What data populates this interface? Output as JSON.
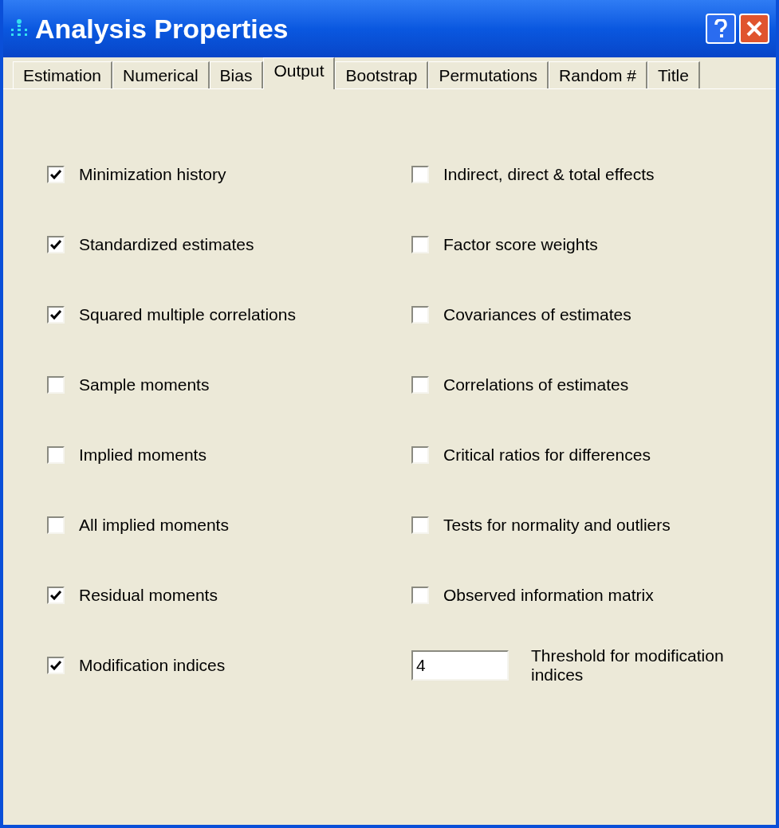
{
  "window": {
    "title": "Analysis Properties"
  },
  "tabs": [
    {
      "label": "Estimation",
      "selected": false
    },
    {
      "label": "Numerical",
      "selected": false
    },
    {
      "label": "Bias",
      "selected": false
    },
    {
      "label": "Output",
      "selected": true
    },
    {
      "label": "Bootstrap",
      "selected": false
    },
    {
      "label": "Permutations",
      "selected": false
    },
    {
      "label": "Random #",
      "selected": false
    },
    {
      "label": "Title",
      "selected": false
    }
  ],
  "left_options": [
    {
      "kind": "checkbox",
      "label": "Minimization history",
      "checked": true
    },
    {
      "kind": "checkbox",
      "label": "Standardized estimates",
      "checked": true
    },
    {
      "kind": "checkbox",
      "label": "Squared multiple correlations",
      "checked": true
    },
    {
      "kind": "checkbox",
      "label": "Sample moments",
      "checked": false
    },
    {
      "kind": "checkbox",
      "label": "Implied moments",
      "checked": false
    },
    {
      "kind": "checkbox",
      "label": "All implied moments",
      "checked": false
    },
    {
      "kind": "checkbox",
      "label": "Residual moments",
      "checked": true
    },
    {
      "kind": "checkbox",
      "label": "Modification indices",
      "checked": true
    }
  ],
  "right_options": [
    {
      "kind": "checkbox",
      "label": "Indirect, direct & total effects",
      "checked": false
    },
    {
      "kind": "checkbox",
      "label": "Factor score weights",
      "checked": false
    },
    {
      "kind": "checkbox",
      "label": "Covariances of estimates",
      "checked": false
    },
    {
      "kind": "checkbox",
      "label": "Correlations of estimates",
      "checked": false
    },
    {
      "kind": "checkbox",
      "label": "Critical ratios for differences",
      "checked": false
    },
    {
      "kind": "checkbox",
      "label": "Tests for normality and outliers",
      "checked": false
    },
    {
      "kind": "checkbox",
      "label": "Observed information matrix",
      "checked": false
    },
    {
      "kind": "field",
      "label": "Threshold for modification indices",
      "value": "4"
    }
  ]
}
